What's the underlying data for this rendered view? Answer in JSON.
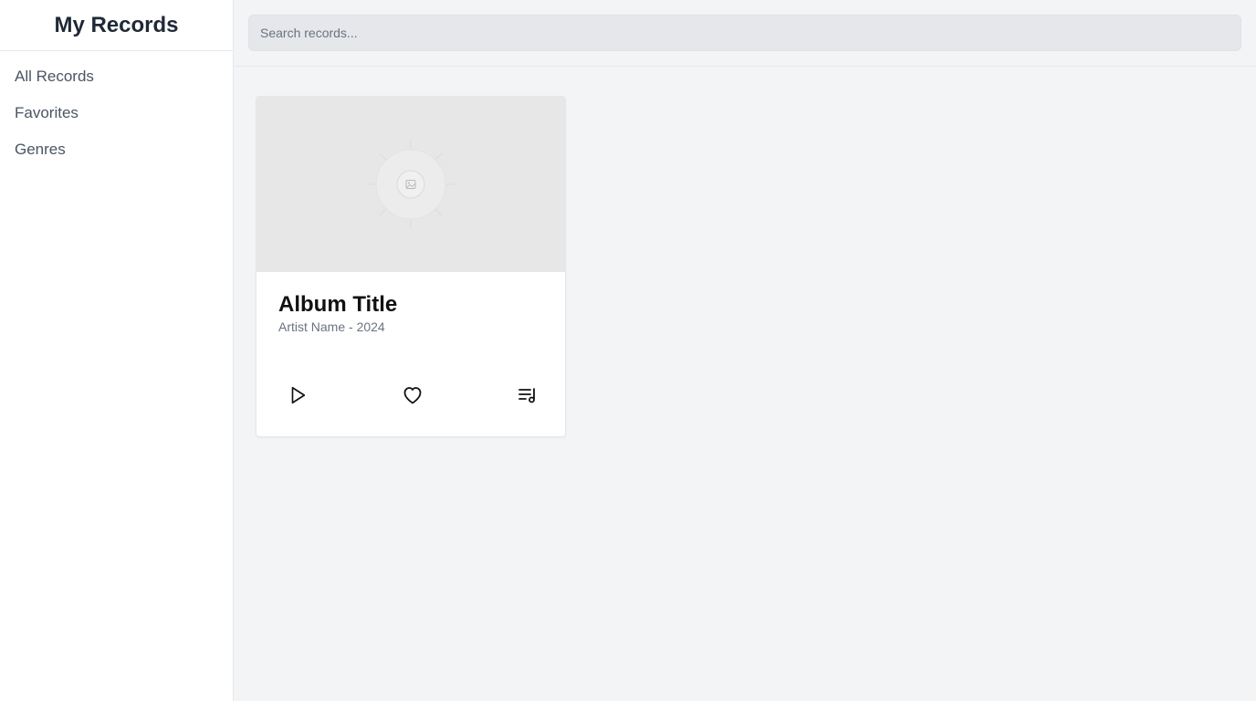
{
  "sidebar": {
    "title": "My Records",
    "items": [
      {
        "label": "All Records"
      },
      {
        "label": "Favorites"
      },
      {
        "label": "Genres"
      }
    ]
  },
  "search": {
    "placeholder": "Search records..."
  },
  "card": {
    "title": "Album Title",
    "subtitle": "Artist Name - 2024",
    "image_icon": "image-placeholder-icon",
    "actions": [
      {
        "name": "play-icon"
      },
      {
        "name": "heart-icon"
      },
      {
        "name": "playlist-icon"
      }
    ]
  },
  "colors": {
    "sidebar_bg": "#ffffff",
    "main_bg": "#f3f4f6",
    "search_bg": "#e5e7eb",
    "title_color": "#1f2937",
    "nav_color": "#4b5563"
  }
}
